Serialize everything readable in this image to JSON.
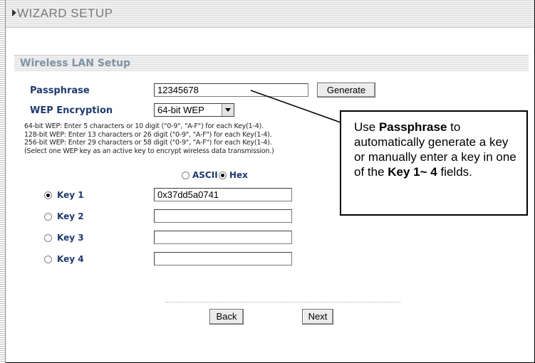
{
  "header": {
    "title": "WIZARD SETUP"
  },
  "section": {
    "title": "Wireless LAN Setup"
  },
  "passphrase": {
    "label": "Passphrase",
    "value": "12345678",
    "generate_label": "Generate"
  },
  "wep": {
    "label": "WEP Encryption",
    "selected": "64-bit WEP"
  },
  "description": {
    "line1": "64-bit WEP: Enter 5 characters or 10 digit (\"0-9\", \"A-F\") for each Key(1-4).",
    "line2": "128-bit WEP: Enter 13 characters or 26 digit (\"0-9\", \"A-F\") for each Key(1-4).",
    "line3": "256-bit WEP: Enter 29 characters or 58 digit (\"0-9\", \"A-F\") for each Key(1-4).",
    "line4": "(Select one WEP key as an active key to encrypt wireless data transmission.)"
  },
  "format": {
    "ascii_label": "ASCII",
    "hex_label": "Hex",
    "selected": "Hex"
  },
  "keys": [
    {
      "label": "Key 1",
      "value": "0x37dd5a0741",
      "selected": true
    },
    {
      "label": "Key 2",
      "value": "",
      "selected": false
    },
    {
      "label": "Key 3",
      "value": "",
      "selected": false
    },
    {
      "label": "Key 4",
      "value": "",
      "selected": false
    }
  ],
  "buttons": {
    "back": "Back",
    "next": "Next"
  },
  "callout": {
    "part1": "Use ",
    "bold1": "Passphrase",
    "part2": " to automatically generate a key or manually enter a key in one of the ",
    "bold2": "Key 1~ 4",
    "part3": " fields."
  }
}
